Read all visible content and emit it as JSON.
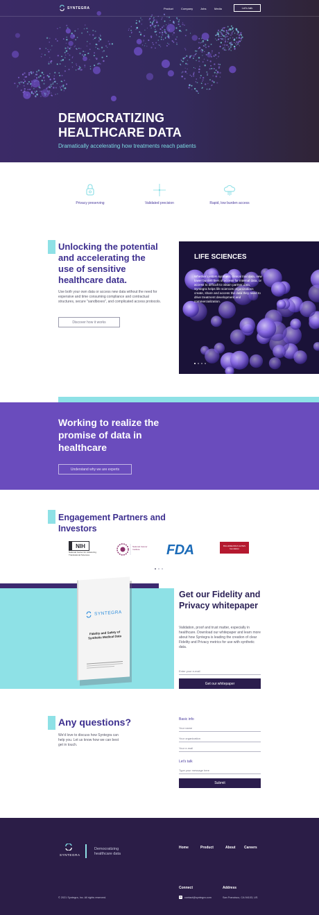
{
  "header": {
    "brand": "SYNTEGRA",
    "nav": [
      "Product",
      "Company",
      "Jobs",
      "Media"
    ],
    "cta": "Let's talk"
  },
  "hero": {
    "title": "DEMOCRATIZING HEALTHCARE DATA",
    "subtitle": "Dramatically accelerating how treatments reach patients"
  },
  "features": [
    {
      "icon": "lock-icon",
      "label": "Privacy preserving"
    },
    {
      "icon": "crosshair-icon",
      "label": "Validated precision"
    },
    {
      "icon": "cloud-icon",
      "label": "Rapid, low burden access"
    }
  ],
  "unlock": {
    "title": "Unlocking the potential and accelerating the use of sensitive healthcare data.",
    "body": "Use both your own data or access new data without the need for expensive and time consuming compliance and contractual structures, secure \"sandboxes\", and complicated access protocols.",
    "button": "Discover how it works"
  },
  "life": {
    "title": "LIFE SCIENCES",
    "body": "Whether custom synthetic clinical trial data, new lower burden tiers of access for internal data, or access to difficult to obtain partner data, Syntegra helps life sciences organizations create, share and access the data they need to drive treatment development and commercialization."
  },
  "working": {
    "title": "Working to realize the promise of data in healthcare",
    "button": "Understand why we are experts"
  },
  "partners": {
    "title": "Engagement Partners and Investors",
    "nih_name": "NIH",
    "nih_caption": "National Center for Advancing Translational Sciences",
    "nci_caption": "National Cancer Institute",
    "fda": "FDA",
    "gates": "BILL&MELINDA GATES foundation"
  },
  "whitepaper": {
    "title": "Get our Fidelity and Privacy whitepaper",
    "body": "Validation, proof and trust matter, especially in healthcare. Download our whitepaper and learn more about how Syntegra is leading the creation of clear Fidelity and Privacy metrics for use with synthetic data.",
    "email_placeholder": "Enter your e-mail",
    "button": "Get our whitepaper",
    "book_brand": "SYNTEGRA",
    "book_title": "Fidelity and Safety of Synthetic Medical Data"
  },
  "questions": {
    "title": "Any questions?",
    "body": "We'd love to discuss how Syntegra can help you. Let us know how we can best get in touch.",
    "basic_info": "Basic info",
    "name_placeholder": "Your name",
    "org_placeholder": "Your organization",
    "email_placeholder": "Your e-mail",
    "talk_heading": "Let's talk",
    "message_placeholder": "Type your message here",
    "submit": "Submit"
  },
  "footer": {
    "brand": "SYNTEGRA",
    "tagline": "Democratizing healthcare data",
    "nav": [
      "Home",
      "Product",
      "About",
      "Careers"
    ],
    "connect": "Connect",
    "address_heading": "Address",
    "email": "contact@syntegra.com",
    "address": "San Francisco, CA 94103, US",
    "copyright": "© 2021 Syntegra, Inc. All rights reserved."
  },
  "colors": {
    "purple": "#6a4cbd",
    "teal": "#8ee1e6",
    "dark": "#2b1d47"
  }
}
